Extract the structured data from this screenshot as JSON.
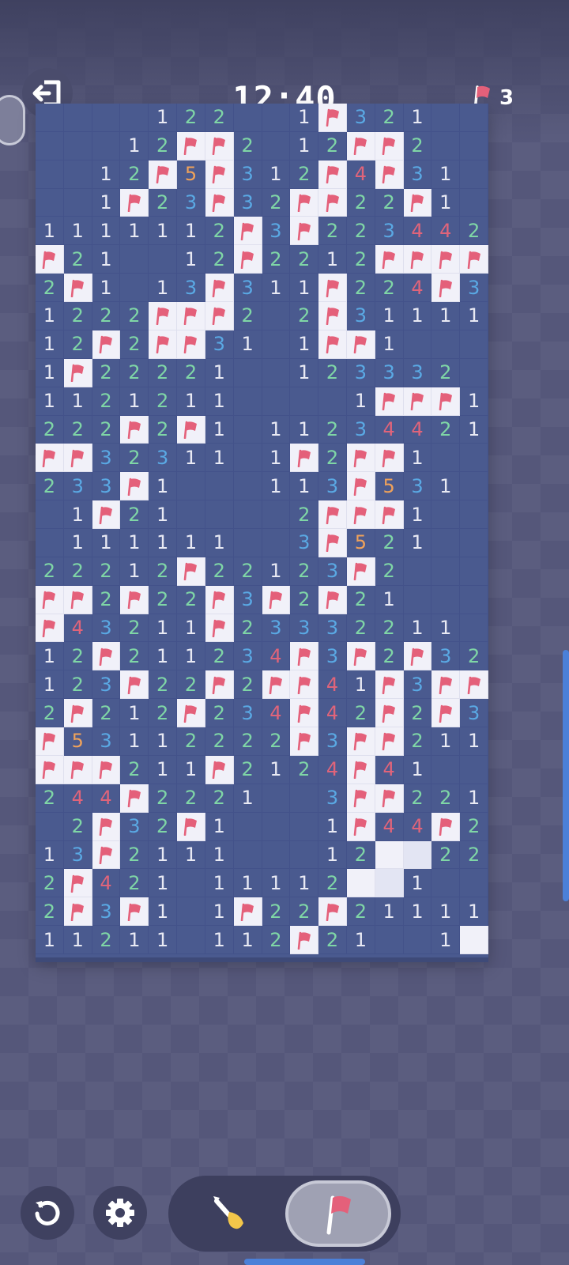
{
  "header": {
    "timer": "12:40",
    "flags_remaining": "3"
  },
  "board": {
    "cols": 16,
    "rows": 30,
    "legend": "Rows as strings: '.'=empty revealed, 'F'=flag, 'U'=unrevealed, digit=number",
    "grid": [
      "....122..1F321..",
      "...12FF2.12FF2..",
      "..12F5F312F4F31.",
      "..1F23F32FF22F1.",
      "1111112F3F223442",
      "F21..12F2212FFFF",
      "2F1.13F311F224F3",
      "1222FFF2.2F31111",
      "12F2FF31.1FF1...",
      "1F22221..123332.",
      "1121211....1FFF1",
      "222F2F1.11234421",
      "FF32311.1F2FF1..",
      "233F1...113F531.",
      ".1F21....2FFF1..",
      ".111111..3F521..",
      "22212F22123F2...",
      "FF2F22F3F2F21...",
      "F43211F23332211.",
      "12F211234F3F2F32",
      "123F22F2FF41F3FF",
      "2F212F234F42F2F3",
      "F53112222F3FF211",
      "FFF211F2124F41..",
      "244F2221..3FF221",
      ".2F32F1...1F44F2F",
      "13F2111...12UU221",
      "2F421.11112UU1..",
      "2F3F1.1F22F21111",
      "11211.112F21..1UU"
    ]
  },
  "colors": {
    "n1": "#e9eaf4",
    "n2": "#7fd6a6",
    "n3": "#5aa9e4",
    "n4": "#e0647a",
    "n5": "#f0a25a",
    "flag": "#e4607a",
    "unrevealed": "#f1f1f9"
  },
  "controls": {
    "mode_selected": "flag"
  }
}
